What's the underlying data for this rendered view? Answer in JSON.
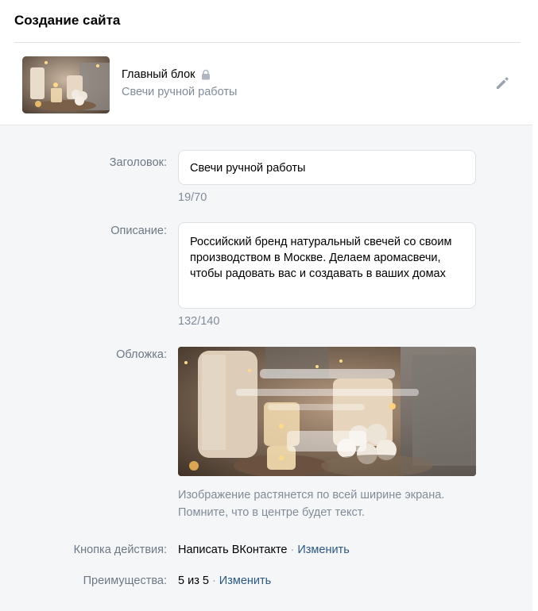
{
  "header": {
    "title": "Создание сайта"
  },
  "block": {
    "title": "Главный блок",
    "subtitle": "Свечи ручной работы",
    "icons": {
      "lock": "lock-icon",
      "edit": "pencil-icon"
    }
  },
  "form": {
    "title_label": "Заголовок:",
    "title_value": "Свечи ручной работы",
    "title_counter": "19/70",
    "description_label": "Описание:",
    "description_value": "Российский бренд натуральный свечей со своим производством в Москве. Делаем аромасвечи, чтобы радовать вас и создавать в ваших домах",
    "description_counter": "132/140",
    "cover_label": "Обложка:",
    "cover_hint": "Изображение растянется по всей ширине экрана. Помните, что в центре будет текст.",
    "action_label": "Кнопка действия:",
    "action_value": "Написать ВКонтакте",
    "action_change": "Изменить",
    "advantages_label": "Преимущества:",
    "advantages_value": "5 из 5",
    "advantages_change": "Изменить",
    "separator": "·"
  },
  "colors": {
    "link": "#2a5885",
    "muted": "#818c99",
    "panel": "#f5f6f8"
  }
}
